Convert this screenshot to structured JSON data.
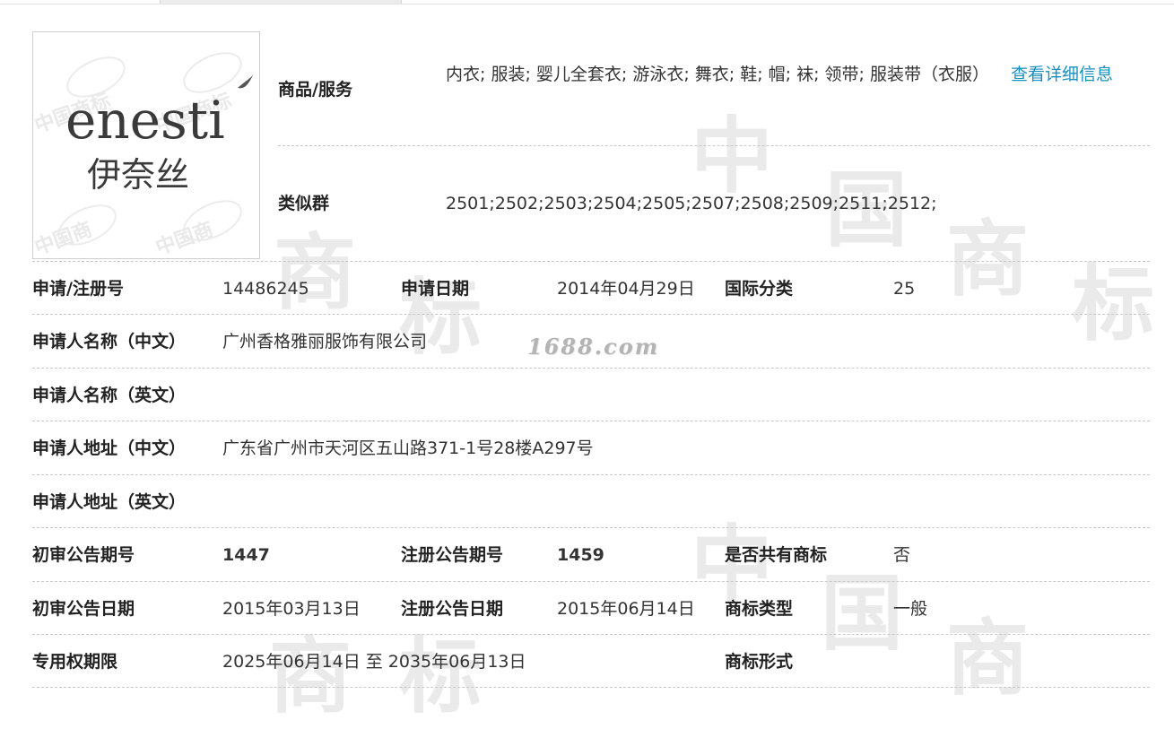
{
  "logo": {
    "brand_text": "enesti",
    "brand_cn": "伊奈丝"
  },
  "goods": {
    "label": "商品/服务",
    "value": "内衣; 服装; 婴儿全套衣; 游泳衣; 舞衣; 鞋; 帽; 袜; 领带; 服装带（衣服）",
    "more_link": "查看详细信息"
  },
  "similar": {
    "label": "类似群",
    "value": "2501;2502;2503;2504;2505;2507;2508;2509;2511;2512;"
  },
  "reg": {
    "label": "申请/注册号",
    "value": "14486245",
    "date_label": "申请日期",
    "date_value": "2014年04月29日",
    "class_label": "国际分类",
    "class_value": "25"
  },
  "applicant_cn": {
    "label": "申请人名称（中文）",
    "value": "广州香格雅丽服饰有限公司"
  },
  "applicant_en": {
    "label": "申请人名称（英文）",
    "value": ""
  },
  "address_cn": {
    "label": "申请人地址（中文）",
    "value": "广东省广州市天河区五山路371-1号28楼A297号"
  },
  "address_en": {
    "label": "申请人地址（英文）",
    "value": ""
  },
  "prelim_no": {
    "label": "初审公告期号",
    "value": "1447",
    "reg_label": "注册公告期号",
    "reg_value": "1459",
    "shared_label": "是否共有商标",
    "shared_value": "否"
  },
  "prelim_date": {
    "label": "初审公告日期",
    "value": "2015年03月13日",
    "reg_label": "注册公告日期",
    "reg_value": "2015年06月14日",
    "type_label": "商标类型",
    "type_value": "一般"
  },
  "term": {
    "label": "专用权期限",
    "value": "2025年06月14日 至 2035年06月13日",
    "form_label": "商标形式",
    "form_value": ""
  },
  "watermarks": {
    "site": "1688.com",
    "big": [
      "中",
      "国",
      "商",
      "标"
    ]
  },
  "colors": {
    "link": "#1a8fbf",
    "divider": "#c9c9c9"
  }
}
